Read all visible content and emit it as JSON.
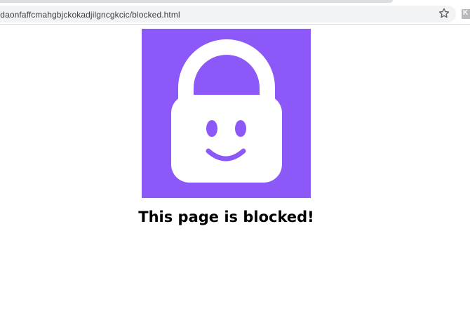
{
  "browser": {
    "url": "://daonfaffcmahgbjckokadjilgncgkcic/blocked.html",
    "bookmark_icon": "star-icon",
    "extension_icon": "extension-icon",
    "extension_letter": "K"
  },
  "page": {
    "image_icon": "smiling-lock-icon",
    "message": "This page is blocked!"
  },
  "colors": {
    "accent": "#8c58f7",
    "lock": "#ffffff"
  }
}
